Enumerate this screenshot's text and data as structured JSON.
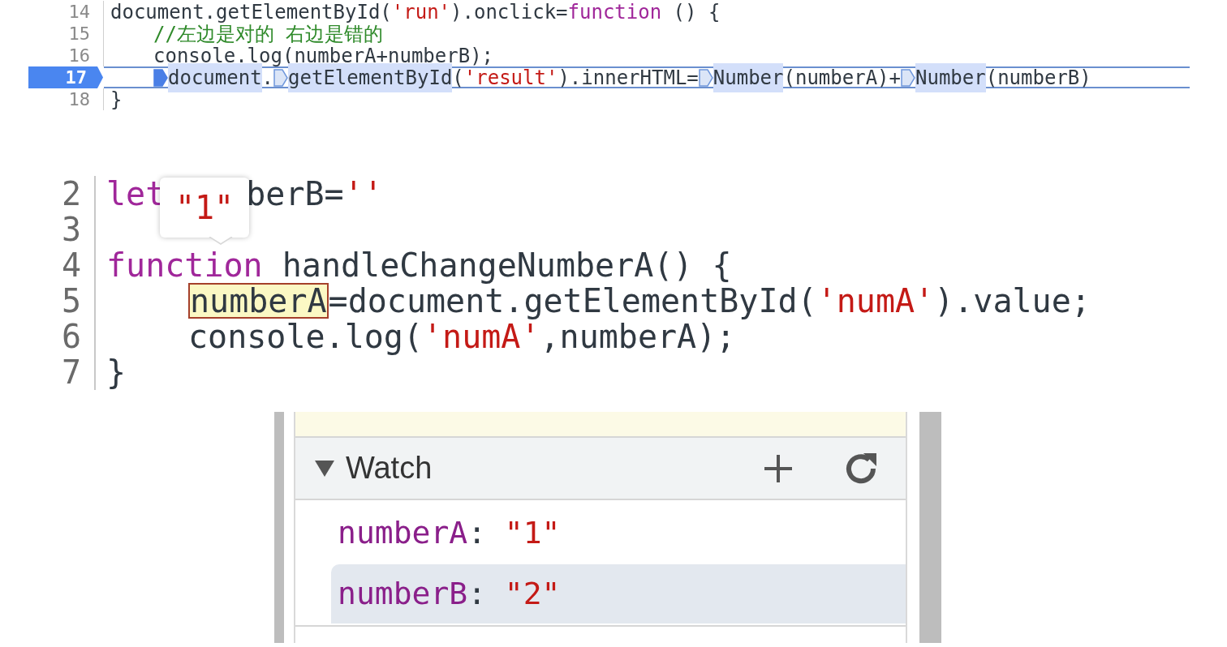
{
  "breakpoint_view": {
    "lines": [
      {
        "number": "14",
        "current": false,
        "indented": false,
        "tokens": [
          {
            "text": "document.getElementById(",
            "kind": "plain"
          },
          {
            "text": "'run'",
            "kind": "string"
          },
          {
            "text": ").onclick=",
            "kind": "plain"
          },
          {
            "text": "function",
            "kind": "keyword"
          },
          {
            "text": " () {",
            "kind": "plain"
          }
        ]
      },
      {
        "number": "15",
        "current": false,
        "indented": true,
        "tokens": [
          {
            "text": "//左边是对的 右边是错的",
            "kind": "comment"
          }
        ]
      },
      {
        "number": "16",
        "current": false,
        "indented": true,
        "tokens": [
          {
            "text": "console.log(numberA+numberB);",
            "kind": "plain"
          }
        ]
      },
      {
        "number": "17",
        "current": true,
        "indented": true,
        "tokens": [
          {
            "text": "document",
            "kind": "plain",
            "marker": true,
            "active": true,
            "highlighted": true
          },
          {
            "text": ".",
            "kind": "plain"
          },
          {
            "text": "getElementById",
            "kind": "plain",
            "marker": true,
            "active": false,
            "highlighted": true
          },
          {
            "text": "(",
            "kind": "plain"
          },
          {
            "text": "'result'",
            "kind": "string"
          },
          {
            "text": ").innerHTML=",
            "kind": "plain"
          },
          {
            "text": "Number",
            "kind": "plain",
            "marker": true,
            "active": false,
            "highlighted": true
          },
          {
            "text": "(numberA)+",
            "kind": "plain"
          },
          {
            "text": "Number",
            "kind": "plain",
            "marker": true,
            "active": false,
            "highlighted": true
          },
          {
            "text": "(numberB)",
            "kind": "plain"
          }
        ]
      },
      {
        "number": "18",
        "current": false,
        "indented": false,
        "tokens": [
          {
            "text": "}",
            "kind": "plain"
          }
        ]
      }
    ]
  },
  "hover_view": {
    "tooltip": {
      "value": "\"1\""
    },
    "lines": [
      {
        "number": "2",
        "indented": false,
        "tokens": [
          {
            "text": "let",
            "kind": "keyword"
          },
          {
            "text": "berB=",
            "kind": "plain",
            "gap": true
          },
          {
            "text": "''",
            "kind": "string"
          }
        ]
      },
      {
        "number": "3"
      },
      {
        "number": "4",
        "indented": false,
        "tokens": [
          {
            "text": "function",
            "kind": "keyword"
          },
          {
            "text": " handleChangeNumberA() {",
            "kind": "plain"
          }
        ]
      },
      {
        "number": "5",
        "indented": true,
        "tokens": [
          {
            "text": "numberA",
            "kind": "plain",
            "hovered": true
          },
          {
            "text": "=document.getElementById(",
            "kind": "plain"
          },
          {
            "text": "'numA'",
            "kind": "string"
          },
          {
            "text": ").value;",
            "kind": "plain"
          }
        ]
      },
      {
        "number": "6",
        "indented": true,
        "tokens": [
          {
            "text": "console.log(",
            "kind": "plain"
          },
          {
            "text": "'numA'",
            "kind": "string"
          },
          {
            "text": ",numberA);",
            "kind": "plain"
          }
        ]
      },
      {
        "number": "7",
        "indented": false,
        "tokens": [
          {
            "text": "}",
            "kind": "plain"
          }
        ]
      }
    ]
  },
  "watch_panel": {
    "title": "Watch",
    "expanded": true,
    "items": [
      {
        "name": "numberA",
        "separator": ":",
        "value": "\"1\"",
        "selected": false
      },
      {
        "name": "numberB",
        "separator": ":",
        "value": "\"2\"",
        "selected": true
      }
    ]
  }
}
